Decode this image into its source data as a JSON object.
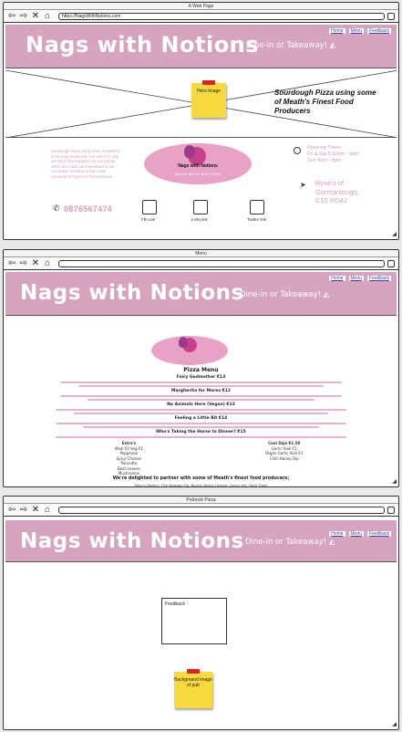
{
  "site": {
    "brand": "Nags with Notions",
    "tagline": "Dine-in or Takeaway!",
    "nav": [
      "Home",
      "Menu",
      "Feedback"
    ]
  },
  "window1": {
    "title": "A Web Page",
    "url": "https://NagsWithNotions.com",
    "hero": {
      "note": "Hero Image",
      "caption": "Sourdough Pizza using some of Meath's Finest Food Producers"
    },
    "about": "Sourdough Pizza using some of Meath's finest food producers. Our aim is to only use local food suppliers for our pizzas which are made each weekend in our converted horsebox in the lovely courtyard of Ryan's of Gormanlough",
    "logo": {
      "title": "Nags with Notions",
      "subtitle": "NAGS WITH NOTIONS"
    },
    "hours": {
      "label": "Opening Times:",
      "line1": "Fri & Sat 5.30pm - 9pm",
      "line2": "Sun 4pm - 8pm"
    },
    "address": {
      "line1": "Ryan's of",
      "line2": "Gormanlough,",
      "line3": "C15 RD42"
    },
    "phone": "0876567474",
    "social": [
      "FB Link",
      "Insta link",
      "Twitter link"
    ]
  },
  "window2": {
    "title": "Menu",
    "menu_title": "Pizza Menu",
    "pizzas": [
      {
        "name": "Fairy Godmother",
        "price": "€13"
      },
      {
        "name": "Margherita for Mares",
        "price": "€12"
      },
      {
        "name": "No Animals Here (Vegan)",
        "price": "€13"
      },
      {
        "name": "Feeling a Little Bit",
        "price": "€14"
      },
      {
        "name": "Who's Taking the Horse to Dinner?",
        "price": "€15"
      }
    ],
    "sides_left": {
      "heading": "Extra's",
      "sub": "Meal €2   Veg €1",
      "items": [
        "Pepperoni",
        "Spicy Chicken",
        "Pancetta",
        "Basil Leaves",
        "Mushrooms"
      ]
    },
    "sides_right": {
      "heading": "Cool Dips €1.50",
      "items": [
        "Garlic Aioli €1",
        "Vegan Garlic Aioli €1",
        "Chilli Honey Dip"
      ]
    },
    "partners_heading": "We're delighted to partner with some of Meath's finest food producers;",
    "partners_line": "Ruby's Bakery, The Wooden Pig, Boyne Valley Cheese, Green Hill, Farm Fresh"
  },
  "window3": {
    "title": "Prebook Pizza",
    "feedback_label": "Feedback",
    "note": "Background image of pub"
  },
  "colors": {
    "brand_pink": "#d6a4bf",
    "text_pink": "#d59bbb",
    "note_yellow": "#f6d93c",
    "pin_red": "#dd2222"
  }
}
